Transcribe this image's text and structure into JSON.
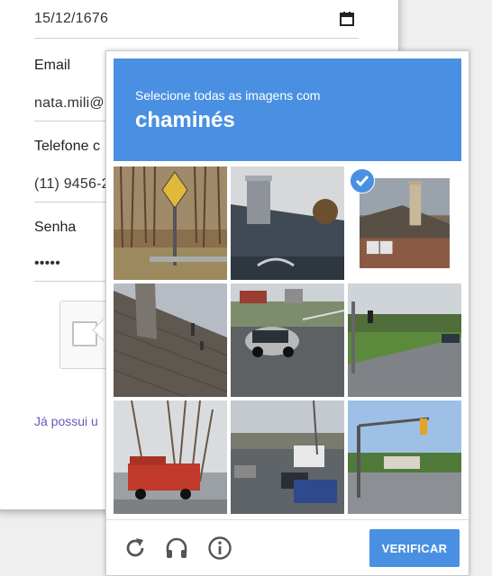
{
  "form": {
    "birthdate_value": "15/12/1676",
    "email_label": "Email",
    "email_value": "nata.mili@",
    "phone_label": "Telefone c",
    "phone_value": "(11) 9456-2",
    "password_label": "Senha",
    "password_value": "•••••",
    "login_link": "Já possui u"
  },
  "captcha": {
    "prompt": "Selecione todas as imagens com",
    "keyword": "chaminés",
    "tiles": [
      {
        "scene": "road-sign-trees",
        "selected": false
      },
      {
        "scene": "gray-roof-chimney",
        "selected": false
      },
      {
        "scene": "brick-house-chimney",
        "selected": true
      },
      {
        "scene": "shingle-roof-chimney",
        "selected": false
      },
      {
        "scene": "parking-lot-car",
        "selected": false
      },
      {
        "scene": "street-intersection",
        "selected": false
      },
      {
        "scene": "red-truck-trees",
        "selected": false
      },
      {
        "scene": "highway-traffic",
        "selected": false
      },
      {
        "scene": "suburban-intersection",
        "selected": false
      }
    ],
    "footer_icons": [
      "reload-icon",
      "headphones-icon",
      "info-icon"
    ],
    "verify_label": "VERIFICAR"
  },
  "colors": {
    "accent": "#4a90e2",
    "link": "#6b56b4"
  }
}
